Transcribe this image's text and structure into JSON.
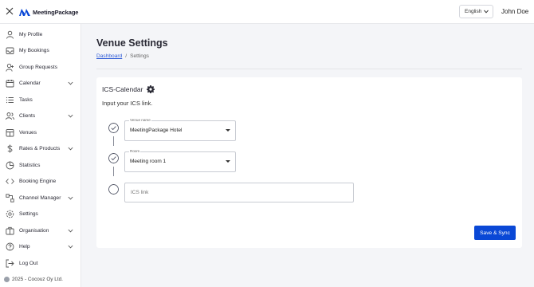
{
  "header": {
    "brand": "MeetingPackage",
    "language": "English",
    "user_name": "John Doe"
  },
  "sidebar": {
    "items": [
      {
        "label": "My Profile",
        "icon": "user-icon",
        "expandable": false
      },
      {
        "label": "My Bookings",
        "icon": "inbox-icon",
        "expandable": false
      },
      {
        "label": "Group Requests",
        "icon": "user-plus-icon",
        "expandable": false
      },
      {
        "label": "Calendar",
        "icon": "calendar-icon",
        "expandable": true
      },
      {
        "label": "Tasks",
        "icon": "list-icon",
        "expandable": false
      },
      {
        "label": "Clients",
        "icon": "users-icon",
        "expandable": true
      },
      {
        "label": "Venues",
        "icon": "building-icon",
        "expandable": false
      },
      {
        "label": "Rates & Products",
        "icon": "dollar-icon",
        "expandable": true
      },
      {
        "label": "Statistics",
        "icon": "pie-chart-icon",
        "expandable": false
      },
      {
        "label": "Booking Engine",
        "icon": "code-icon",
        "expandable": false
      },
      {
        "label": "Channel Manager",
        "icon": "share-nodes-icon",
        "expandable": true
      },
      {
        "label": "Settings",
        "icon": "gear-icon",
        "expandable": false
      },
      {
        "label": "Organisation",
        "icon": "briefcase-icon",
        "expandable": true
      },
      {
        "label": "Help",
        "icon": "help-icon",
        "expandable": true
      },
      {
        "label": "Log Out",
        "icon": "logout-icon",
        "expandable": false
      }
    ],
    "footer": "2025 - Cocouz Oy Ltd."
  },
  "main": {
    "title": "Venue Settings",
    "breadcrumb": {
      "link": "Dashboard",
      "separator": "/",
      "current": "Settings"
    },
    "card": {
      "title": "ICS-Calendar",
      "subtitle": "Input your ICS link.",
      "fields": {
        "venue": {
          "label": "Venue name",
          "value": "MeetingPackage Hotel"
        },
        "room": {
          "label": "Room",
          "value": "Meeting room 1"
        },
        "ics": {
          "placeholder": "ICS link",
          "value": ""
        }
      },
      "save_label": "Save & Sync"
    }
  },
  "colors": {
    "primary": "#0a48d6",
    "link": "#2f5bd6",
    "background": "#f4f5f8"
  }
}
